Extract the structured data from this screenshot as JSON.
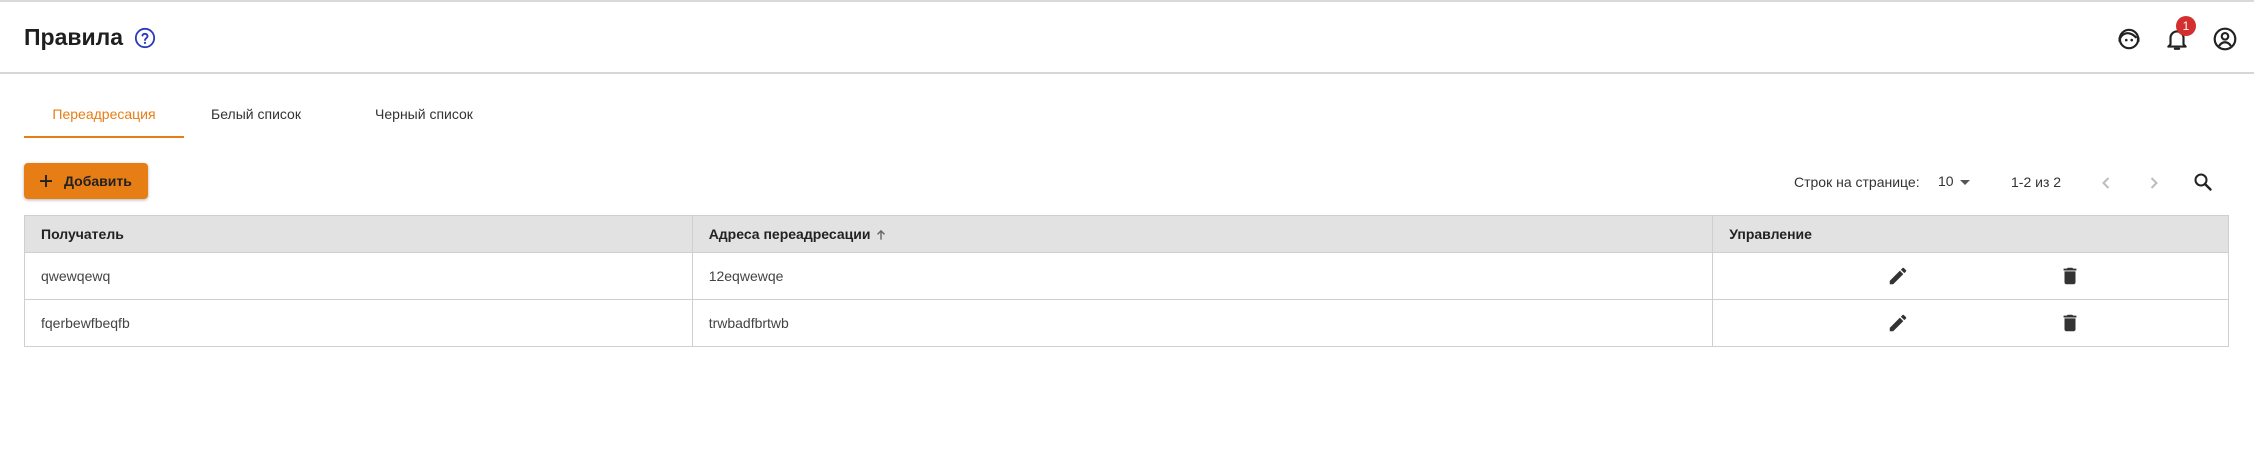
{
  "header": {
    "title": "Правила",
    "icons": [
      "help-icon",
      "support-agent-icon",
      "bell-icon",
      "account-circle-icon"
    ],
    "notification_count": "1"
  },
  "tabs": [
    {
      "label": "Переадресация",
      "active": true
    },
    {
      "label": "Белый список",
      "active": false
    },
    {
      "label": "Черный список",
      "active": false
    }
  ],
  "toolbar": {
    "add_label": "Добавить",
    "rows_per_page_label": "Строк на странице:",
    "rows_per_page_value": "10",
    "range_text": "1-2 из 2"
  },
  "table": {
    "columns": [
      "Получатель",
      "Адреса переадресации",
      "Управление"
    ],
    "sorted_column": "Адреса переадресации",
    "sort_direction": "asc",
    "rows": [
      {
        "recipient": "qwewqewq",
        "forward": "12eqwewqe"
      },
      {
        "recipient": "fqerbewfbeqfb",
        "forward": "trwbadfbrtwb"
      }
    ]
  },
  "colors": {
    "accent": "#e67e15",
    "badge": "#d32f2f",
    "header_bg": "#e2e2e2"
  }
}
